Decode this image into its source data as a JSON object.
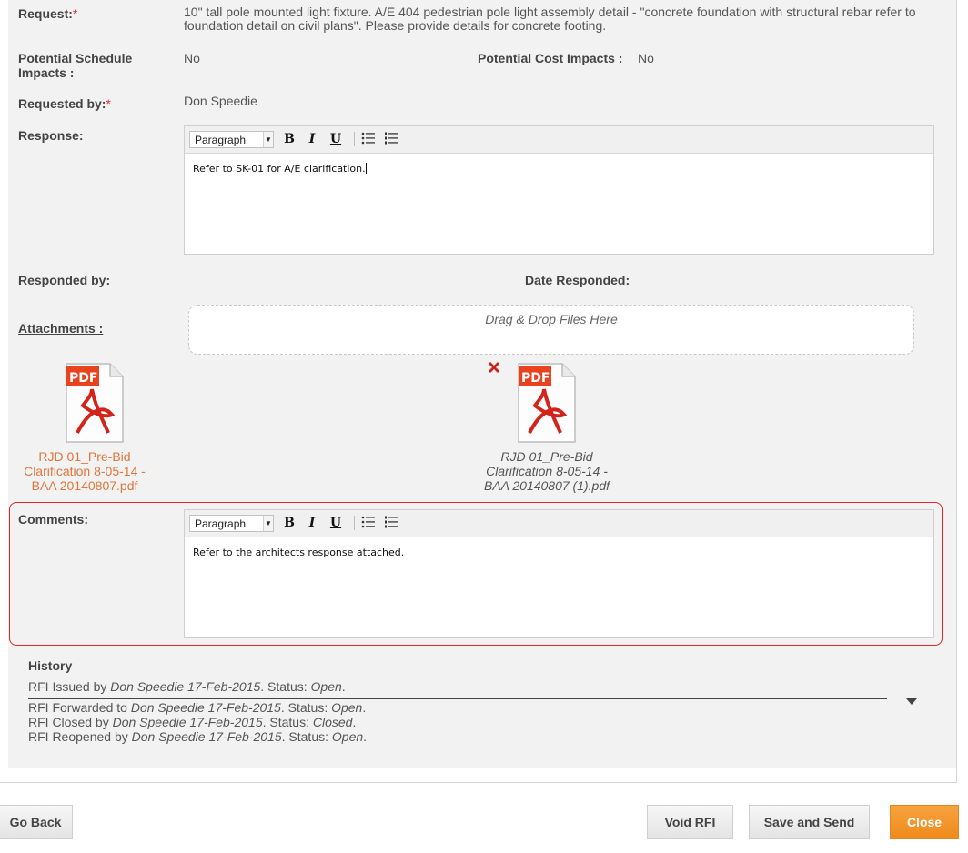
{
  "request": {
    "label": "Request:",
    "required_mark": "*",
    "text": "10\" tall pole mounted light fixture.  A/E 404 pedestrian pole light assembly detail - \"concrete foundation with structural rebar refer to foundation detail on civil plans\".  Please provide details for concrete footing."
  },
  "schedule_impacts": {
    "label_line1": "Potential Schedule",
    "label_line2": "Impacts :",
    "value": "No"
  },
  "cost_impacts": {
    "label": "Potential Cost Impacts :",
    "value": "No"
  },
  "requested_by": {
    "label": "Requested by:",
    "required_mark": "*",
    "value": "Don Speedie"
  },
  "response": {
    "label": "Response:",
    "editor": {
      "format": "Paragraph",
      "bold": "B",
      "italic": "I",
      "underline": "U",
      "bullet_list_icon": "bullet-list-icon",
      "numbered_list_icon": "numbered-list-icon",
      "content": "Refer to SK-01 for A/E clarification."
    }
  },
  "responded_by": {
    "label": "Responded by:"
  },
  "date_responded": {
    "label": "Date Responded:"
  },
  "attachments": {
    "label": "Attachments :",
    "dropzone_text": "Drag & Drop Files Here",
    "files": [
      {
        "line1": "RJD 01_Pre-Bid",
        "line2": "Clarification 8-05-14 -",
        "line3": "BAA 20140807.pdf",
        "icon": "pdf-icon",
        "color": "#e0763c"
      },
      {
        "line1": "RJD 01_Pre-Bid",
        "line2": "Clarification 8-05-14 -",
        "line3": "BAA 20140807 (1).pdf",
        "icon": "pdf-icon",
        "remove_icon": "remove-x-icon"
      }
    ]
  },
  "comments": {
    "label": "Comments:",
    "editor": {
      "format": "Paragraph",
      "bold": "B",
      "italic": "I",
      "underline": "U",
      "content": "Refer to the architects response attached."
    },
    "highlight_color": "#e0262a"
  },
  "history": {
    "title": "History",
    "entries": [
      {
        "prefix": "RFI Issued by ",
        "who": "Don Speedie 17-Feb-2015",
        "mid": ". Status: ",
        "status": "Open",
        "end": "."
      },
      {
        "prefix": "RFI Forwarded to ",
        "who": "Don Speedie 17-Feb-2015",
        "mid": ". Status: ",
        "status": "Open",
        "end": "."
      },
      {
        "prefix": "RFI Closed by ",
        "who": "Don Speedie 17-Feb-2015",
        "mid": ". Status: ",
        "status": "Closed",
        "end": "."
      },
      {
        "prefix": "RFI Reopened by ",
        "who": "Don Speedie 17-Feb-2015",
        "mid": ". Status: ",
        "status": "Open",
        "end": "."
      }
    ],
    "toggle_icon": "chevron-down-icon"
  },
  "buttons": {
    "go_back": "Go Back",
    "void_rfi": "Void RFI",
    "save_and_send": "Save and Send",
    "close": "Close"
  },
  "colors": {
    "accent_orange": "#ef8a1d",
    "required_red": "#d33"
  }
}
